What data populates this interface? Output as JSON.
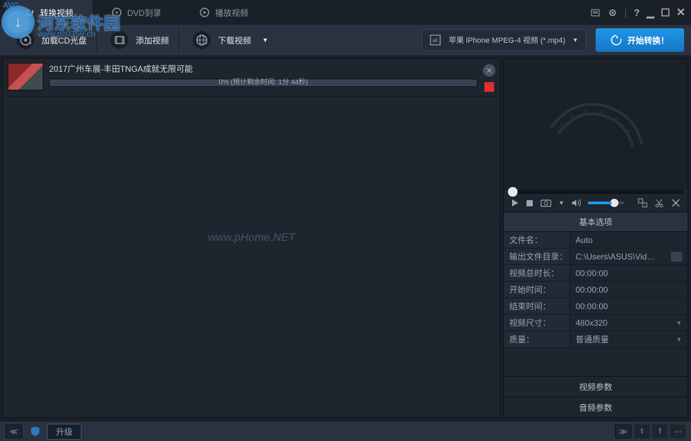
{
  "logo": {
    "avc": "AVC",
    "site": "河东软件园",
    "url": "www.pc0359.cn"
  },
  "tabs": [
    {
      "label": "转换视频",
      "active": true
    },
    {
      "label": "DVD刻录",
      "active": false
    },
    {
      "label": "播放视频",
      "active": false
    }
  ],
  "toolbar": {
    "load_cd": "加载CD光盘",
    "add_video": "添加视频",
    "download_video": "下载视频",
    "format": "苹果 iPhone MPEG-4 视频 (*.mp4)",
    "start_convert": "开始转换！"
  },
  "file_list": {
    "items": [
      {
        "title": "2017广州车展-丰田TNGA成就无限可能",
        "progress_text": "0% (预计剩余时间: 1分 44秒)"
      }
    ]
  },
  "watermark_center": "www.pHome.NET",
  "options": {
    "header": "基本选项",
    "rows": {
      "filename_label": "文件名：",
      "filename_value": "Auto",
      "output_label": "输出文件目录：",
      "output_value": "C:\\Users\\ASUS\\Videos\\...",
      "duration_label": "视频总时长：",
      "duration_value": "00:00:00",
      "start_label": "开始时间：",
      "start_value": "00:00:00",
      "end_label": "结束时间：",
      "end_value": "00:00:00",
      "size_label": "视频尺寸：",
      "size_value": "480x320",
      "quality_label": "质量：",
      "quality_value": "普通质量"
    },
    "video_params": "视频参数",
    "audio_params": "音频参数"
  },
  "bottom": {
    "upgrade": "升级"
  }
}
